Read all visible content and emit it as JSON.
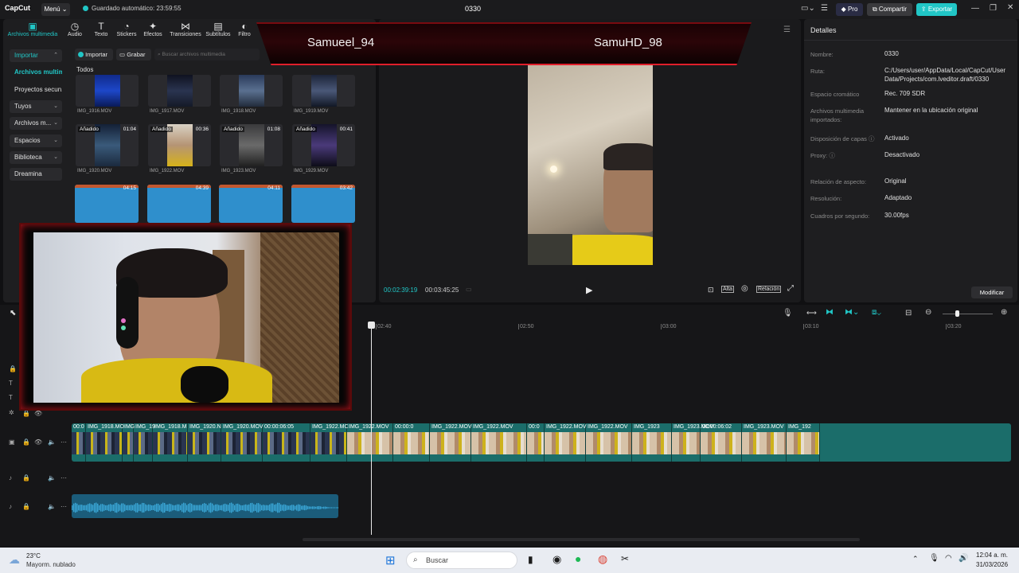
{
  "titlebar": {
    "logo": "CapCut",
    "menu_label": "Menú",
    "autosave": "Guardado automático: 23:59:55",
    "project_name": "0330",
    "pro_label": "Pro",
    "share_label": "Compartir",
    "export_label": "Exportar"
  },
  "toolbar": {
    "tabs": [
      {
        "label": "Archivos multimedia",
        "icon": "media-icon"
      },
      {
        "label": "Audio",
        "icon": "audio-icon"
      },
      {
        "label": "Texto",
        "icon": "text-icon"
      },
      {
        "label": "Stickers",
        "icon": "sticker-icon"
      },
      {
        "label": "Efectos",
        "icon": "effects-icon"
      },
      {
        "label": "Transiciones",
        "icon": "transitions-icon"
      },
      {
        "label": "Subtítulos",
        "icon": "subtitles-icon"
      },
      {
        "label": "Filtro",
        "icon": "filter-icon"
      }
    ]
  },
  "sidebar": {
    "items": [
      {
        "label": "Importar"
      },
      {
        "label": "Archivos multim..."
      },
      {
        "label": "Proyectos secun..."
      },
      {
        "label": "Tuyos"
      },
      {
        "label": "Archivos m..."
      },
      {
        "label": "Espacios"
      },
      {
        "label": "Biblioteca"
      },
      {
        "label": "Dreamina"
      }
    ]
  },
  "media": {
    "import_label": "Importar",
    "record_label": "Grabar",
    "search_placeholder": "Buscar archivos multimedia",
    "filter_label": "Todos",
    "row1": [
      {
        "name": "IMG_1916.MOV"
      },
      {
        "name": "IMG_1917.MOV"
      },
      {
        "name": "IMG_1918.MOV"
      },
      {
        "name": "IMG_1919.MOV"
      }
    ],
    "row2": [
      {
        "name": "IMG_1920.MOV",
        "tag": "Añadido",
        "duration": "01:04"
      },
      {
        "name": "IMG_1922.MOV",
        "tag": "Añadido",
        "duration": "00:36"
      },
      {
        "name": "IMG_1923.MOV",
        "tag": "Añadido",
        "duration": "01:08"
      },
      {
        "name": "IMG_1929.MOV",
        "tag": "Añadido",
        "duration": "00:41"
      }
    ],
    "row3": [
      {
        "duration": "04:15"
      },
      {
        "duration": "04:39"
      },
      {
        "duration": "04:11"
      },
      {
        "duration": "03:42"
      }
    ]
  },
  "overlay": {
    "player1": "Samueel_94",
    "player2": "SamuHD_98"
  },
  "player": {
    "current_time": "00:02:39:19",
    "total_time": "00:03:45:25",
    "quality_label": "Alta",
    "ratio_label": "Relación"
  },
  "details": {
    "title": "Detalles",
    "rows": [
      {
        "label": "Nombre:",
        "value": "0330"
      },
      {
        "label": "Ruta:",
        "value": "C:/Users/user/AppData/Local/CapCut/User Data/Projects/com.lveditor.draft/0330"
      },
      {
        "label": "Espacio cromático",
        "value": "Rec. 709 SDR"
      },
      {
        "label": "Archivos multimedia importados:",
        "value": "Mantener en la ubicación original"
      },
      {
        "label": "Disposición de capas",
        "value": "Activado"
      },
      {
        "label": "Proxy:",
        "value": "Desactivado"
      },
      {
        "label": "Relación de aspecto:",
        "value": "Original"
      },
      {
        "label": "Resolución:",
        "value": "Adaptado"
      },
      {
        "label": "Cuadros por segundo:",
        "value": "30.00fps"
      }
    ],
    "modify_label": "Modificar"
  },
  "timeline": {
    "ruler": [
      "02:40",
      "02:50",
      "03:00",
      "03:10",
      "03:20"
    ],
    "clips": [
      {
        "label": "00:0"
      },
      {
        "label": "IMG_1918.MO"
      },
      {
        "label": "IMG"
      },
      {
        "label": "IMG_19"
      },
      {
        "label": "IMG_1918.M"
      },
      {
        "label": "IMG_1920.N"
      },
      {
        "label": "IMG_1920.MOV"
      },
      {
        "label": "00:00:06:05"
      },
      {
        "label": "IMG_1922.MC"
      },
      {
        "label": "IMG_1922.MOV"
      },
      {
        "label": "00:00:0"
      },
      {
        "label": "IMG_1922.MOV"
      },
      {
        "label": "IMG_1922.MOV"
      },
      {
        "label": "00:0"
      },
      {
        "label": "IMG_1922.MOV"
      },
      {
        "label": "IMG_1922.MOV"
      },
      {
        "label": "IMG_1923"
      },
      {
        "label": "IMG_1923.MOV"
      },
      {
        "label": "00:00:06:02"
      },
      {
        "label": "IMG_1923.MOV"
      },
      {
        "label": "IMG_192"
      }
    ]
  },
  "taskbar": {
    "weather_temp": "23°C",
    "weather_desc": "Mayorm. nublado",
    "search_label": "Buscar",
    "time": "12:04 a. m.",
    "date": "31/03/2026"
  },
  "colors": {
    "accent": "#21c6c6",
    "panel": "#1e1e20",
    "overlay_red": "#e01e2a"
  }
}
